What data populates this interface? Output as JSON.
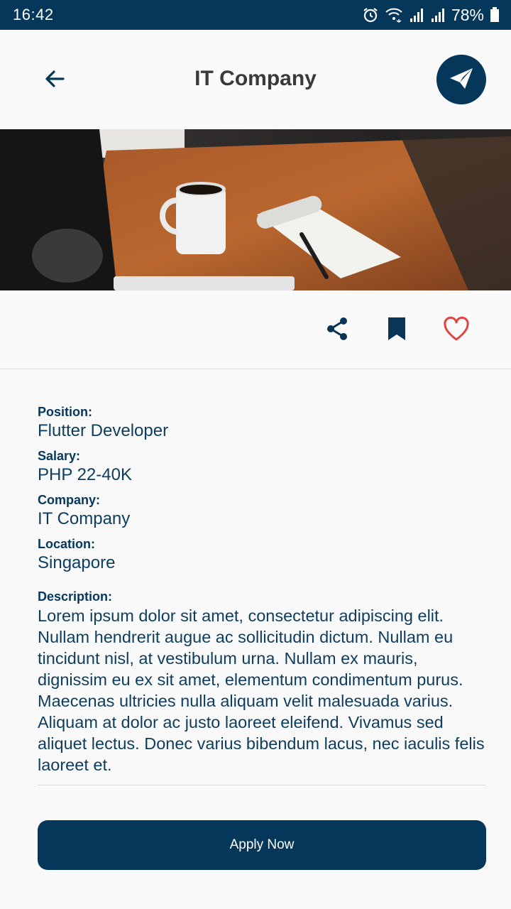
{
  "status_bar": {
    "time": "16:42",
    "battery": "78%",
    "icons": [
      "alarm-icon",
      "wifi-icon",
      "signal-icon",
      "signal-icon",
      "battery-icon"
    ]
  },
  "app_bar": {
    "title": "IT Company",
    "back_icon": "arrow-left-icon",
    "send_icon": "send-icon"
  },
  "actions": {
    "icons": [
      "share-icon",
      "bookmark-icon",
      "heart-outline-icon"
    ]
  },
  "job": {
    "position_label": "Position:",
    "position": "Flutter Developer",
    "salary_label": "Salary:",
    "salary": "PHP 22-40K",
    "company_label": "Company:",
    "company": "IT Company",
    "location_label": "Location:",
    "location": "Singapore",
    "description_label": "Description:",
    "description": "Lorem ipsum dolor sit amet, consectetur adipiscing elit. Nullam hendrerit augue ac sollicitudin dictum. Nullam eu tincidunt nisl, at vestibulum urna. Nullam ex mauris, dignissim eu ex sit amet, elementum condimentum purus. Maecenas ultricies nulla aliquam velit malesuada varius. Aliquam at dolor ac justo laoreet eleifend. Vivamus sed aliquet lectus. Donec varius bibendum lacus, nec iaculis felis laoreet et."
  },
  "apply_button": "Apply Now",
  "colors": {
    "primary": "#05375a",
    "heart": "#e0463f",
    "background": "#f9f9f9"
  }
}
